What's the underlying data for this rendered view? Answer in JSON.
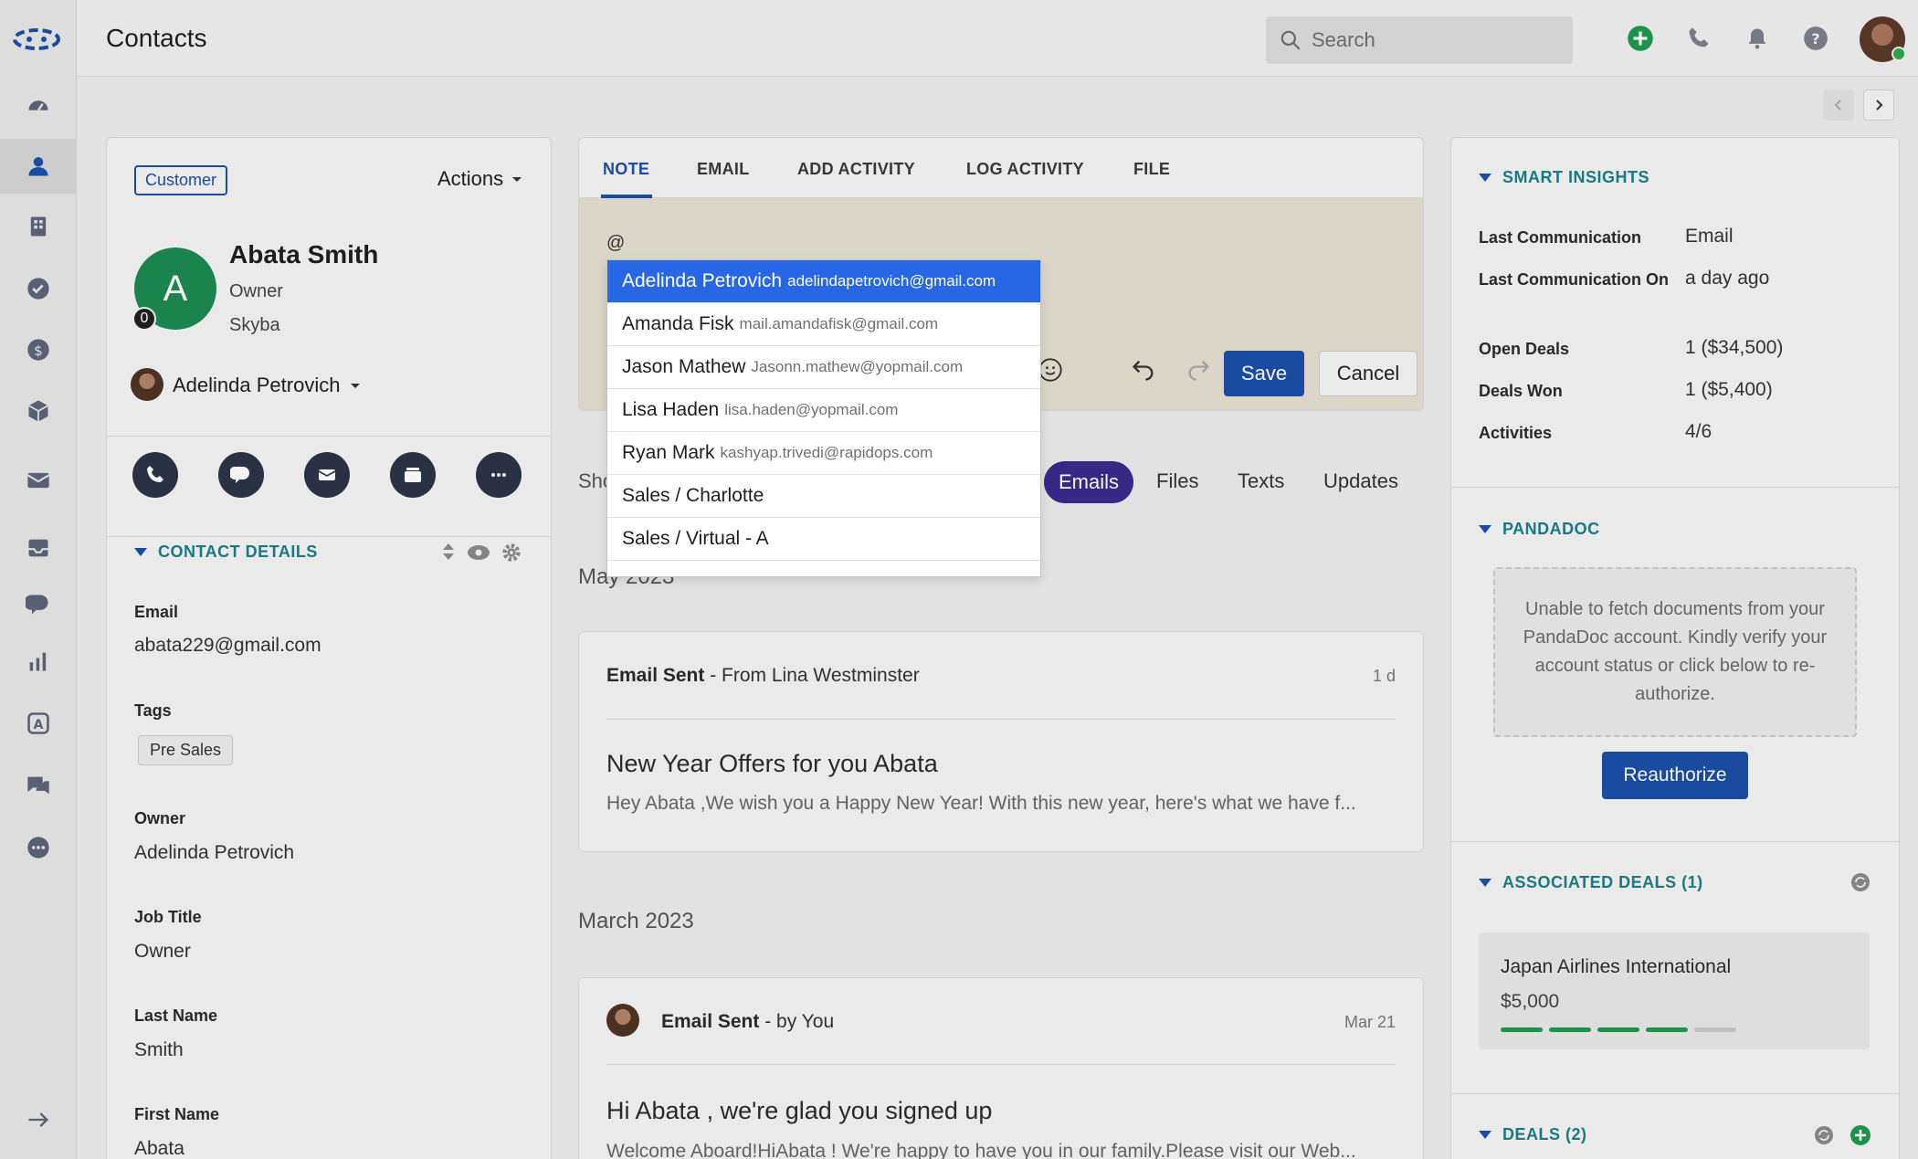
{
  "header": {
    "title": "Contacts",
    "search_placeholder": "Search"
  },
  "profile": {
    "badge": "Customer",
    "actions_label": "Actions",
    "avatar_letter": "A",
    "avatar_count": "0",
    "name": "Abata Smith",
    "role": "Owner",
    "company": "Skyba",
    "owner": "Adelinda Petrovich"
  },
  "contact_details": {
    "title": "CONTACT DETAILS",
    "fields": [
      {
        "label": "Email",
        "value": "abata229@gmail.com"
      },
      {
        "label": "Tags",
        "value": "Pre Sales"
      },
      {
        "label": "Owner",
        "value": "Adelinda Petrovich"
      },
      {
        "label": "Job Title",
        "value": "Owner"
      },
      {
        "label": "Last Name",
        "value": "Smith"
      },
      {
        "label": "First Name",
        "value": "Abata"
      }
    ]
  },
  "composer": {
    "tabs": [
      "NOTE",
      "EMAIL",
      "ADD ACTIVITY",
      "LOG ACTIVITY",
      "FILE"
    ],
    "text": "@",
    "save_label": "Save",
    "cancel_label": "Cancel"
  },
  "mention_list": [
    {
      "name": "Adelinda Petrovich",
      "email": "adelindapetrovich@gmail.com"
    },
    {
      "name": "Amanda Fisk",
      "email": "mail.amandafisk@gmail.com"
    },
    {
      "name": "Jason Mathew",
      "email": "Jasonn.mathew@yopmail.com"
    },
    {
      "name": "Lisa Haden",
      "email": "lisa.haden@yopmail.com"
    },
    {
      "name": "Ryan Mark",
      "email": "kashyap.trivedi@rapidops.com"
    },
    {
      "name": "Sales / Charlotte",
      "email": ""
    },
    {
      "name": "Sales / Virtual - A",
      "email": ""
    }
  ],
  "timeline": {
    "show_label": "Sho",
    "filters": [
      "Emails",
      "Files",
      "Texts",
      "Updates"
    ],
    "month1": "May 2023",
    "month2": "March 2023",
    "entries": [
      {
        "type": "Email Sent",
        "by": "- From Lina Westminster",
        "time": "1 d",
        "subject": "New Year Offers for you Abata",
        "snippet": "Hey Abata ,We wish you a Happy New Year! With this new year, here's what we have f..."
      },
      {
        "type": "Email Sent",
        "by": "- by You",
        "time": "Mar 21",
        "subject": "Hi Abata , we're glad you signed up",
        "snippet": "Welcome Aboard!HiAbata ! We're happy to have you in our family.Please visit our Web..."
      }
    ]
  },
  "insights": {
    "title": "SMART INSIGHTS",
    "rows": [
      {
        "label": "Last Communication",
        "value": "Email"
      },
      {
        "label": "Last Communication On",
        "value": "a day ago"
      },
      {
        "label": "Open Deals",
        "value": "1 ($34,500)"
      },
      {
        "label": "Deals Won",
        "value": "1 ($5,400)"
      },
      {
        "label": "Activities",
        "value": "4/6"
      }
    ]
  },
  "pandadoc": {
    "title": "PANDADOC",
    "message": "Unable to fetch documents from your PandaDoc account. Kindly verify your account status or click below to re-authorize.",
    "button": "Reauthorize"
  },
  "associated_deals": {
    "title": "ASSOCIATED DEALS (1)",
    "deal_name": "Japan Airlines International",
    "deal_amount": "$5,000",
    "stages_completed": 4,
    "stages_total": 5
  },
  "deals": {
    "title": "DEALS (2)"
  },
  "colors": {
    "brand_blue": "#1d4fa8",
    "teal_heading": "#1a7e86",
    "selected_mention": "#2767e6",
    "emails_pill": "#3b2a8c",
    "stage_done": "#1d9a4d"
  }
}
